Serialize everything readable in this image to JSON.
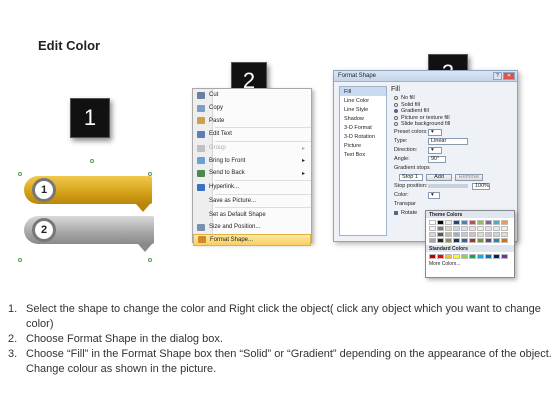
{
  "title": "Edit Color",
  "steps": [
    "1",
    "2",
    "3"
  ],
  "shapes": {
    "labels": [
      "1",
      "2"
    ],
    "colors": {
      "gold": "#d4a017",
      "gray": "#a6a6a6"
    }
  },
  "context_menu": {
    "items": [
      {
        "label": "Cut",
        "icon": "scissors-icon",
        "color": "#6b7fa3"
      },
      {
        "label": "Copy",
        "icon": "copy-icon",
        "color": "#7f9cc4"
      },
      {
        "label": "Paste",
        "icon": "paste-icon",
        "color": "#c9a34a"
      },
      {
        "label": "Edit Text",
        "icon": "edit-text-icon",
        "color": "#5b7fb5"
      },
      {
        "label": "Group",
        "icon": "group-icon",
        "color": "#c0c0c0",
        "disabled": true,
        "submenu": true
      },
      {
        "label": "Bring to Front",
        "icon": "bring-front-icon",
        "color": "#6aa0d8",
        "submenu": true
      },
      {
        "label": "Send to Back",
        "icon": "send-back-icon",
        "color": "#4a8a4a",
        "submenu": true
      },
      {
        "label": "Hyperlink...",
        "icon": "hyperlink-icon",
        "color": "#3a6fc4"
      },
      {
        "label": "Save as Picture...",
        "icon": "",
        "color": ""
      },
      {
        "label": "Set as Default Shape",
        "icon": "",
        "color": ""
      },
      {
        "label": "Size and Position...",
        "icon": "size-icon",
        "color": "#7a8fb0"
      },
      {
        "label": "Format Shape...",
        "icon": "format-shape-icon",
        "color": "#d08a2a",
        "highlighted": true
      }
    ]
  },
  "dialog": {
    "title": "Format Shape",
    "categories": [
      "Fill",
      "Line Color",
      "Line Style",
      "Shadow",
      "3-D Format",
      "3-D Rotation",
      "Picture",
      "Text Box"
    ],
    "pane_heading": "Fill",
    "fill_options": [
      {
        "label": "No fill",
        "selected": false
      },
      {
        "label": "Solid fill",
        "selected": false
      },
      {
        "label": "Gradient fill",
        "selected": true
      },
      {
        "label": "Picture or texture fill",
        "selected": false
      },
      {
        "label": "Slide background fill",
        "selected": false
      }
    ],
    "preset_colors_label": "Preset colors:",
    "type_label": "Type:",
    "type_value": "Linear",
    "direction_label": "Direction:",
    "angle_label": "Angle:",
    "angle_value": "90°",
    "gradient_stops_label": "Gradient stops",
    "stop_value": "Stop 1",
    "add_label": "Add",
    "remove_label": "Remove",
    "stop_position_label": "Stop position:",
    "stop_position_value": "100%",
    "color_label": "Color:",
    "transparency_label": "Transpar",
    "rotate_label": "Rotate"
  },
  "palette": {
    "theme_label": "Theme Colors",
    "standard_label": "Standard Colors",
    "more_label": "More Colors...",
    "theme_top": [
      "#ffffff",
      "#000000",
      "#eeece1",
      "#1f497d",
      "#4f81bd",
      "#c0504d",
      "#9bbb59",
      "#8064a2",
      "#4bacc6",
      "#f79646"
    ],
    "theme_tints": [
      "#f2f2f2",
      "#7f7f7f",
      "#ddd9c3",
      "#c6d9f0",
      "#dbe5f1",
      "#f2dcdb",
      "#ebf1dd",
      "#e5e0ec",
      "#dbeef3",
      "#fdeada"
    ],
    "theme_shades": [
      "#d8d8d8",
      "#595959",
      "#c4bd97",
      "#8db3e2",
      "#b8cce4",
      "#e5b9b7",
      "#d7e3bc",
      "#ccc1d9",
      "#b7dde8",
      "#fbd5b5"
    ],
    "theme_dark": [
      "#a5a5a5",
      "#262626",
      "#938953",
      "#17365d",
      "#366092",
      "#953734",
      "#76923c",
      "#5f497a",
      "#31859b",
      "#e36c09"
    ],
    "standard": [
      "#c00000",
      "#ff0000",
      "#ffc000",
      "#ffff00",
      "#92d050",
      "#00b050",
      "#00b0f0",
      "#0070c0",
      "#002060",
      "#7030a0"
    ]
  },
  "instructions": [
    {
      "num": "1.",
      "text": "Select the shape to change the color and Right click the object( click any object which you want to change color)"
    },
    {
      "num": "2.",
      "text": "Choose Format Shape in the dialog box."
    },
    {
      "num": "3.",
      "text": "Choose “Fill” in the Format Shape box then “Solid” or “Gradient” depending on the appearance of the object. Change colour as shown in the picture."
    }
  ]
}
